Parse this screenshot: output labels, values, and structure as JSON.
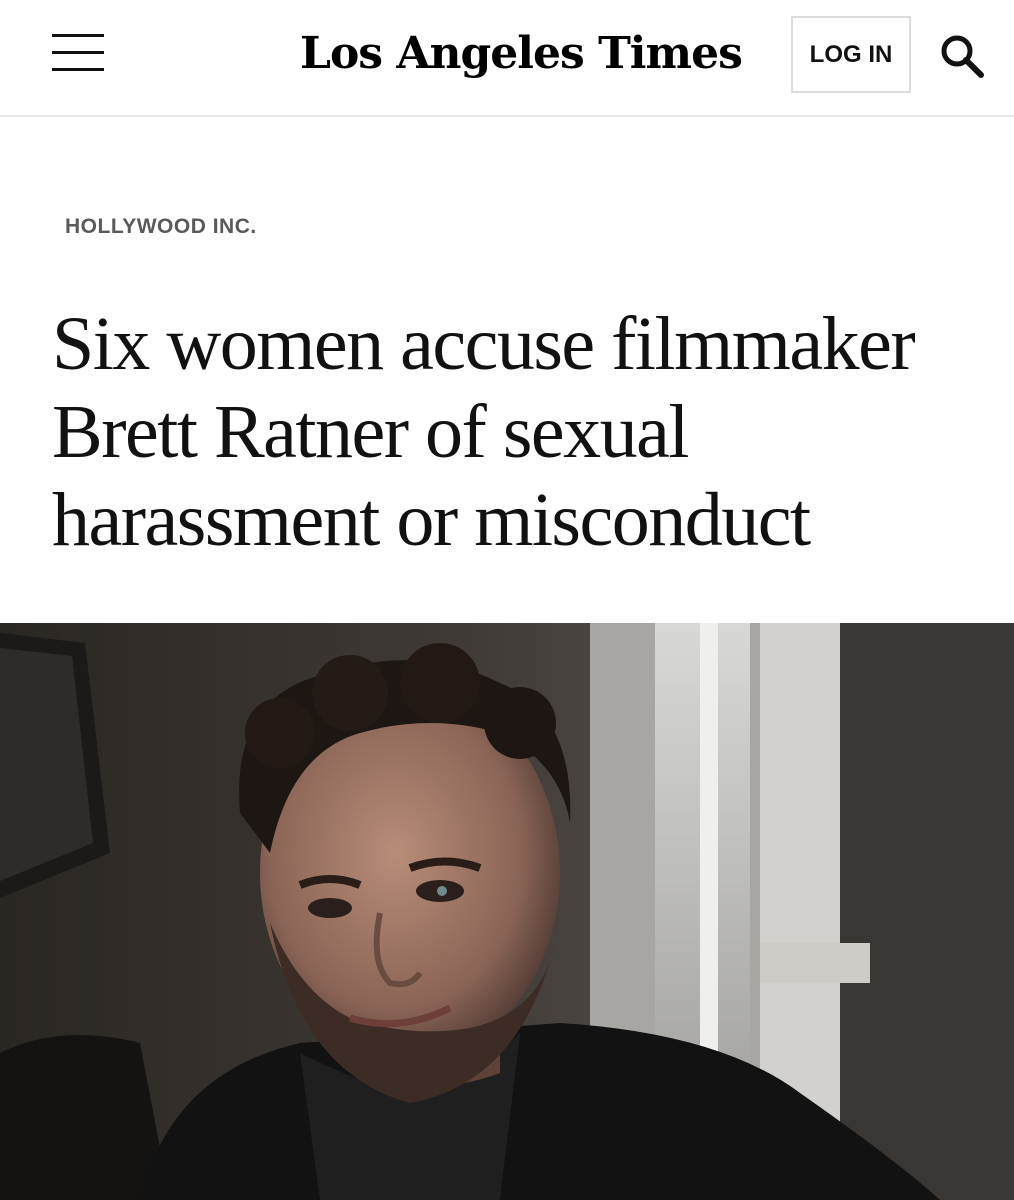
{
  "header": {
    "logo_text": "Los Angeles Times",
    "login_label": "LOG IN",
    "menu_icon": "hamburger-menu-icon",
    "search_icon": "search-icon"
  },
  "article": {
    "section": "HOLLYWOOD INC.",
    "headline": "Six women accuse filmmaker Brett Ratner of sexual harassment or misconduct"
  },
  "colors": {
    "text": "#111111",
    "section_label": "#5a5a5a",
    "header_border": "#e6e6e6",
    "login_border": "#dcdcdc"
  }
}
